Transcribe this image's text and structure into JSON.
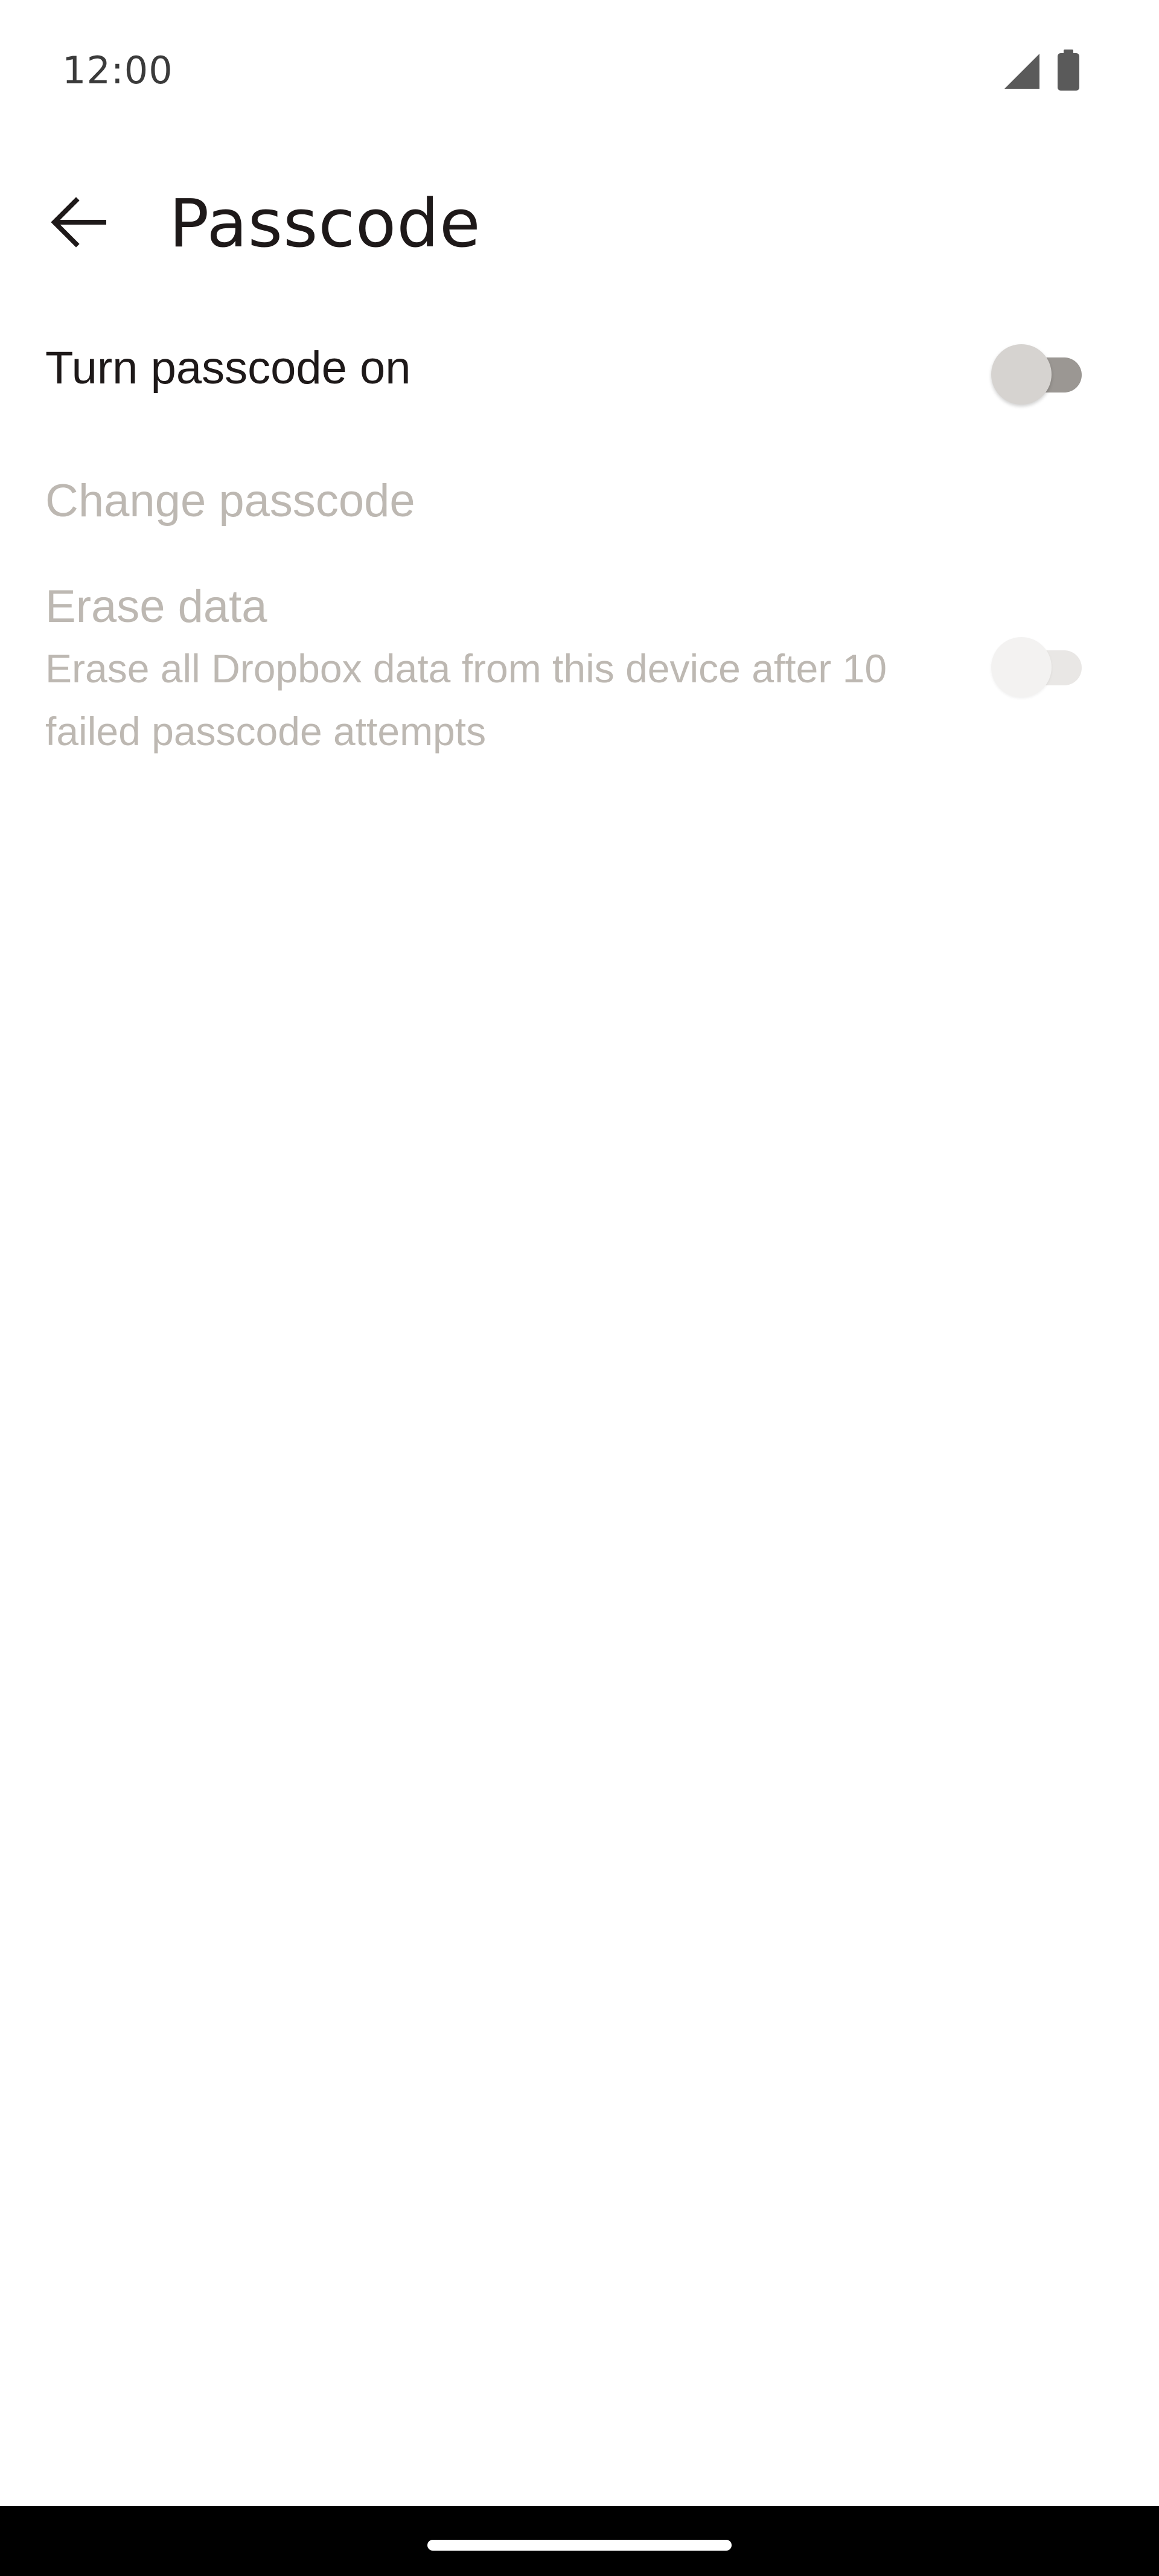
{
  "status_bar": {
    "time": "12:00",
    "icons": [
      "signal-icon",
      "battery-icon"
    ]
  },
  "app_bar": {
    "back_icon": "arrow-left-icon",
    "title": "Passcode"
  },
  "settings": {
    "turn_on": {
      "title": "Turn passcode on",
      "enabled": true,
      "checked": false
    },
    "change": {
      "title": "Change passcode",
      "enabled": false
    },
    "erase": {
      "title": "Erase data",
      "subtitle": "Erase all Dropbox data from this device after 10 failed passcode attempts",
      "enabled": false,
      "checked": false
    }
  },
  "colors": {
    "text_primary": "#1e1919",
    "text_disabled": "#bdb8b2",
    "toggle_track_off": "#9b9793",
    "toggle_thumb_off": "#d6d3d0",
    "nav_bar": "#000000"
  }
}
